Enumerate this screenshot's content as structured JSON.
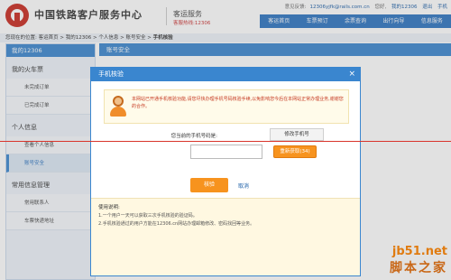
{
  "header": {
    "site_title": "中国铁路客户服务中心",
    "service_name": "客运服务",
    "hotline": "客服热线:12306",
    "top_links": {
      "feedback_label": "意见反馈:",
      "feedback_email": "12306yjfk@rails.com.cn",
      "greeting": "您好,",
      "my_12306": "我的12306",
      "logout": "退出",
      "mobile": "手机"
    }
  },
  "nav": {
    "items": [
      "客运首页",
      "车票预订",
      "余票查询",
      "出行向导",
      "信息服务"
    ]
  },
  "breadcrumb": {
    "prefix": "您现在的位置:",
    "items": [
      "客运首页",
      "我的12306",
      "个人信息",
      "账号安全"
    ],
    "current": "手机核验",
    "separator": ">"
  },
  "sidebar": {
    "header": "我的12306",
    "groups": [
      {
        "title": "我的火车票",
        "items": [
          "未完成订单",
          "已完成订单"
        ]
      },
      {
        "title": "个人信息",
        "items": [
          "查看个人信息",
          "账号安全"
        ]
      },
      {
        "title": "常用信息管理",
        "items": [
          "常用联系人",
          "车票快递地址"
        ]
      }
    ],
    "active_item": "账号安全"
  },
  "main": {
    "panel_title": "账号安全"
  },
  "modal": {
    "title": "手机核验",
    "close_icon": "×",
    "notice": "本网站已开通手机核验功能,请您尽快办理手机号码核验手续,以免影响您今后在本网站正常办理业务,谢谢您的合作。",
    "phone_label": "您当前的手机号码是:",
    "phone_value": "",
    "change_phone_button": "修改手机号",
    "code_label": "验证码:",
    "code_input_value": "",
    "resend_button": "重新获取(34)",
    "verify_button": "核验",
    "cancel_link": "取消",
    "usage_title": "使用说明:",
    "usage_lines": [
      "1.一个用户一天可以获取三次手机核验的验证码。",
      "2.手机核验通过的用户方能在12306.cn网站办理邮箱修改、密码找回等业务。"
    ]
  },
  "watermark": {
    "domain": "jb51.net",
    "brand": "脚本之家"
  },
  "colors": {
    "brand_blue": "#3a86cf",
    "accent_orange": "#f7931e",
    "annotation_red": "#d9342b",
    "notice_red": "#c5371f"
  }
}
